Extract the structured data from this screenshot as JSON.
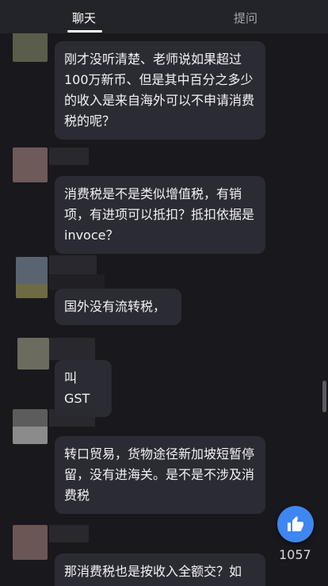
{
  "tabs": {
    "chat": "聊天",
    "questions": "提问"
  },
  "messages": [
    {
      "text": "刚才没听清楚、老师说如果超过100万新币、但是其中百分之多少的收入是来自海外可以不申请消费税的呢？"
    },
    {
      "text": "消费税是不是类似增值税，有销项，有进项可以抵扣？抵扣依据是invoce？"
    },
    {
      "text": "国外没有流转税，"
    },
    {
      "text": "叫GST"
    },
    {
      "text": "转口贸易，货物途径新加坡短暂停留，没有进海关。是不是不涉及消费税"
    },
    {
      "text": "那消费税也是按收入全额交？如"
    }
  ],
  "like": {
    "count": "1057",
    "icon": "thumbs-up-icon",
    "color": "#3f86f0"
  }
}
